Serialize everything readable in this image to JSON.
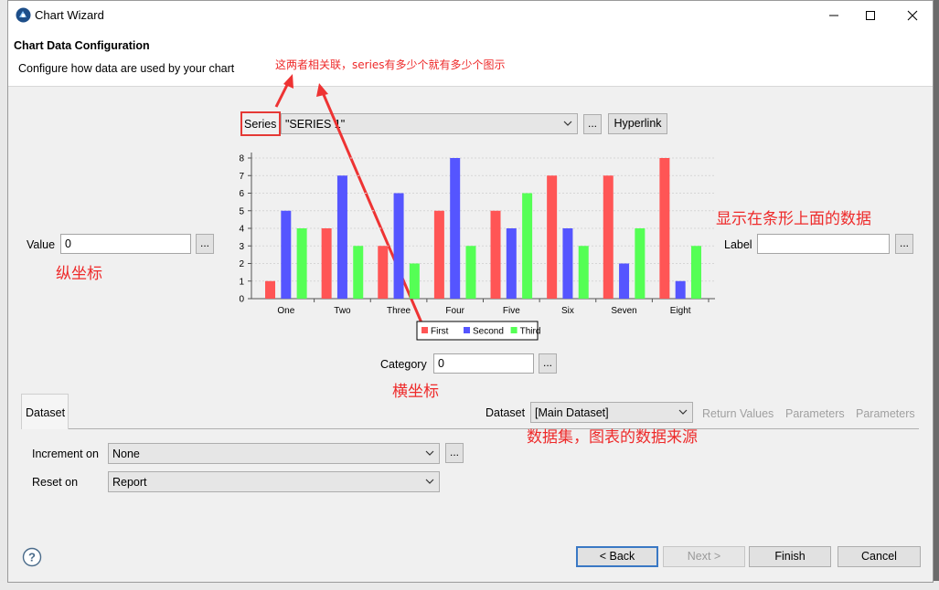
{
  "window": {
    "title": "Chart Wizard",
    "minimize_icon": "minimize-icon",
    "maximize_icon": "maximize-icon",
    "close_icon": "close-icon"
  },
  "header": {
    "title": "Chart Data Configuration",
    "description": "Configure how data are used by your chart"
  },
  "series": {
    "label": "Series",
    "value": "\"SERIES 1\"",
    "ellipsis": "...",
    "hyperlink": "Hyperlink"
  },
  "value_field": {
    "label": "Value",
    "value": "0",
    "ellipsis": "..."
  },
  "label_field": {
    "label": "Label",
    "value": "",
    "ellipsis": "..."
  },
  "category_field": {
    "label": "Category",
    "value": "0",
    "ellipsis": "..."
  },
  "tabs": {
    "dataset_tab": "Dataset",
    "dataset_label": "Dataset",
    "dataset_value": "[Main Dataset]",
    "return_values": "Return Values",
    "parameters_1": "Parameters",
    "parameters_2": "Parameters"
  },
  "increment": {
    "label": "Increment on",
    "value": "None",
    "ellipsis": "..."
  },
  "reset": {
    "label": "Reset on",
    "value": "Report"
  },
  "footer": {
    "help_icon": "help-icon",
    "back": "< Back",
    "next": "Next >",
    "finish": "Finish",
    "cancel": "Cancel"
  },
  "annotations": {
    "series_note": "这两者相关联，series有多少个就有多少个图示",
    "label_note": "显示在条形上面的数据",
    "value_note": "纵坐标",
    "category_note": "横坐标",
    "dataset_note": "数据集，图表的数据来源"
  },
  "colors": {
    "first": "#ff5555",
    "second": "#5555ff",
    "third": "#55ff55",
    "annotation": "#ee2a2a",
    "primary_button_border": "#3a78c4"
  },
  "chart_data": {
    "type": "bar",
    "categories": [
      "One",
      "Two",
      "Three",
      "Four",
      "Five",
      "Six",
      "Seven",
      "Eight"
    ],
    "series": [
      {
        "name": "First",
        "values": [
          1,
          4,
          3,
          5,
          5,
          7,
          7,
          8
        ]
      },
      {
        "name": "Second",
        "values": [
          5,
          7,
          6,
          8,
          4,
          4,
          2,
          1
        ]
      },
      {
        "name": "Third",
        "values": [
          4,
          3,
          2,
          3,
          6,
          3,
          4,
          3
        ]
      }
    ],
    "yticks": [
      "0",
      "1",
      "2",
      "3",
      "4",
      "5",
      "6",
      "7",
      "8"
    ],
    "ylim": [
      0,
      8
    ],
    "grid": true,
    "legend": "bottom"
  }
}
